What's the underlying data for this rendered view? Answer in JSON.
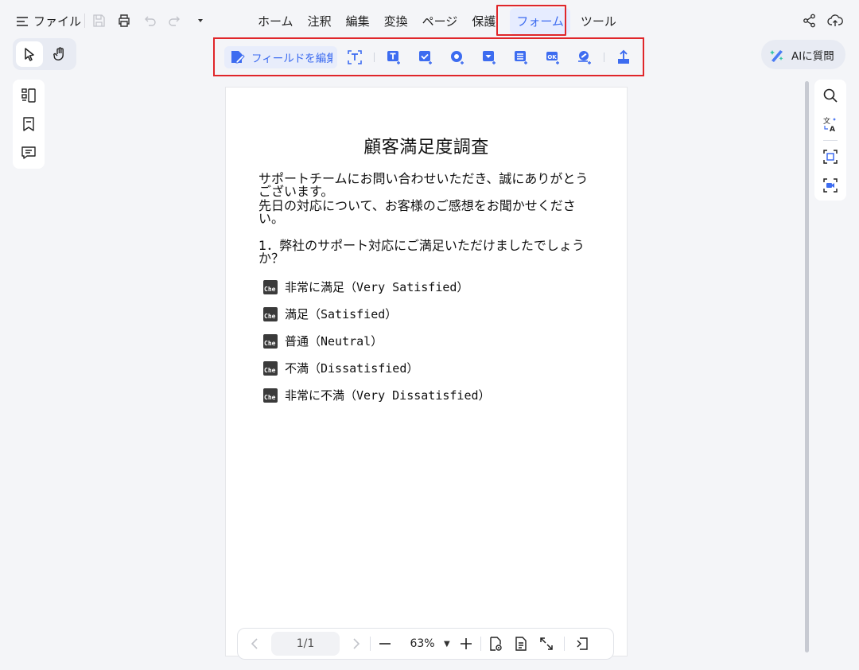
{
  "file_menu": {
    "label": "ファイル"
  },
  "menu_tabs": [
    {
      "label": "ホーム"
    },
    {
      "label": "注釈"
    },
    {
      "label": "編集"
    },
    {
      "label": "変換"
    },
    {
      "label": "ページ"
    },
    {
      "label": "保護"
    },
    {
      "label": "フォーム",
      "active": true
    },
    {
      "label": "ツール"
    }
  ],
  "form_toolbar": {
    "edit_field_label": "フィールドを編集",
    "icons": [
      "text-recognition-icon",
      "text-field-icon",
      "checkbox-field-icon",
      "radio-button-icon",
      "dropdown-field-icon",
      "list-box-icon",
      "push-button-icon",
      "signature-field-icon",
      "export-icon"
    ]
  },
  "ai_button": {
    "label": "AIに質問"
  },
  "document": {
    "title": "顧客満足度調査",
    "paragraph1": "サポートチームにお問い合わせいただき、誠にありがとうございます。",
    "paragraph2": "先日の対応について、お客様のご感想をお聞かせください。",
    "question1": "1．弊社のサポート対応にご満足いただけましたでしょうか？",
    "checkbox_text": "Che",
    "options": [
      {
        "label": "非常に満足（Very Satisfied）"
      },
      {
        "label": "満足（Satisfied）"
      },
      {
        "label": "普通（Neutral）"
      },
      {
        "label": "不満（Dissatisfied）"
      },
      {
        "label": "非常に不満（Very Dissatisfied）"
      }
    ]
  },
  "bottom_bar": {
    "page_indicator": "1/1",
    "zoom": "63%"
  },
  "colors": {
    "accent": "#3d6cf0",
    "highlight_border": "#e0262a",
    "background": "#f4f5f8"
  }
}
